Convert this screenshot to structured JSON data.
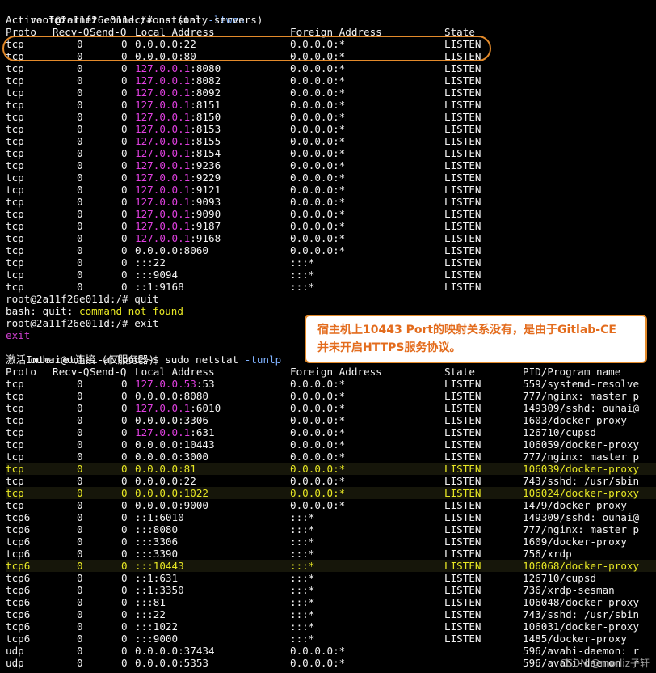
{
  "session1": {
    "prompt": "root@2a11f26e011d:/# netstat",
    "flags": "-ltwen",
    "title": "Active Internet connections (only servers)",
    "header": [
      "Proto",
      "Recv-Q",
      "Send-Q",
      "Local Address",
      "Foreign Address",
      "State"
    ],
    "rows": [
      {
        "proto": "tcp",
        "recv": "0",
        "send": "0",
        "ip": "0.0.0.0",
        "port": ":22",
        "foreign": "0.0.0.0:*",
        "state": "LISTEN",
        "loop": false
      },
      {
        "proto": "tcp",
        "recv": "0",
        "send": "0",
        "ip": "0.0.0.0",
        "port": ":80",
        "foreign": "0.0.0.0:*",
        "state": "LISTEN",
        "loop": false
      },
      {
        "proto": "tcp",
        "recv": "0",
        "send": "0",
        "ip": "127.0.0.1",
        "port": ":8080",
        "foreign": "0.0.0.0:*",
        "state": "LISTEN",
        "loop": true
      },
      {
        "proto": "tcp",
        "recv": "0",
        "send": "0",
        "ip": "127.0.0.1",
        "port": ":8082",
        "foreign": "0.0.0.0:*",
        "state": "LISTEN",
        "loop": true
      },
      {
        "proto": "tcp",
        "recv": "0",
        "send": "0",
        "ip": "127.0.0.1",
        "port": ":8092",
        "foreign": "0.0.0.0:*",
        "state": "LISTEN",
        "loop": true
      },
      {
        "proto": "tcp",
        "recv": "0",
        "send": "0",
        "ip": "127.0.0.1",
        "port": ":8151",
        "foreign": "0.0.0.0:*",
        "state": "LISTEN",
        "loop": true
      },
      {
        "proto": "tcp",
        "recv": "0",
        "send": "0",
        "ip": "127.0.0.1",
        "port": ":8150",
        "foreign": "0.0.0.0:*",
        "state": "LISTEN",
        "loop": true
      },
      {
        "proto": "tcp",
        "recv": "0",
        "send": "0",
        "ip": "127.0.0.1",
        "port": ":8153",
        "foreign": "0.0.0.0:*",
        "state": "LISTEN",
        "loop": true
      },
      {
        "proto": "tcp",
        "recv": "0",
        "send": "0",
        "ip": "127.0.0.1",
        "port": ":8155",
        "foreign": "0.0.0.0:*",
        "state": "LISTEN",
        "loop": true
      },
      {
        "proto": "tcp",
        "recv": "0",
        "send": "0",
        "ip": "127.0.0.1",
        "port": ":8154",
        "foreign": "0.0.0.0:*",
        "state": "LISTEN",
        "loop": true
      },
      {
        "proto": "tcp",
        "recv": "0",
        "send": "0",
        "ip": "127.0.0.1",
        "port": ":9236",
        "foreign": "0.0.0.0:*",
        "state": "LISTEN",
        "loop": true
      },
      {
        "proto": "tcp",
        "recv": "0",
        "send": "0",
        "ip": "127.0.0.1",
        "port": ":9229",
        "foreign": "0.0.0.0:*",
        "state": "LISTEN",
        "loop": true
      },
      {
        "proto": "tcp",
        "recv": "0",
        "send": "0",
        "ip": "127.0.0.1",
        "port": ":9121",
        "foreign": "0.0.0.0:*",
        "state": "LISTEN",
        "loop": true
      },
      {
        "proto": "tcp",
        "recv": "0",
        "send": "0",
        "ip": "127.0.0.1",
        "port": ":9093",
        "foreign": "0.0.0.0:*",
        "state": "LISTEN",
        "loop": true
      },
      {
        "proto": "tcp",
        "recv": "0",
        "send": "0",
        "ip": "127.0.0.1",
        "port": ":9090",
        "foreign": "0.0.0.0:*",
        "state": "LISTEN",
        "loop": true
      },
      {
        "proto": "tcp",
        "recv": "0",
        "send": "0",
        "ip": "127.0.0.1",
        "port": ":9187",
        "foreign": "0.0.0.0:*",
        "state": "LISTEN",
        "loop": true
      },
      {
        "proto": "tcp",
        "recv": "0",
        "send": "0",
        "ip": "127.0.0.1",
        "port": ":9168",
        "foreign": "0.0.0.0:*",
        "state": "LISTEN",
        "loop": true
      },
      {
        "proto": "tcp",
        "recv": "0",
        "send": "0",
        "ip": "0.0.0.0",
        "port": ":8060",
        "foreign": "0.0.0.0:*",
        "state": "LISTEN",
        "loop": false
      },
      {
        "proto": "tcp",
        "recv": "0",
        "send": "0",
        "ip": "::",
        "port": ":22",
        "foreign": ":::*",
        "state": "LISTEN",
        "loop": false
      },
      {
        "proto": "tcp",
        "recv": "0",
        "send": "0",
        "ip": "::",
        "port": ":9094",
        "foreign": ":::*",
        "state": "LISTEN",
        "loop": false
      },
      {
        "proto": "tcp",
        "recv": "0",
        "send": "0",
        "ip": "::1",
        "port": ":9168",
        "foreign": ":::*",
        "state": "LISTEN",
        "loop": false
      }
    ],
    "quit_prompt": "root@2a11f26e011d:/# quit",
    "bash_prefix": "bash: quit: ",
    "bash_error": "command not found",
    "exit_prompt": "root@2a11f26e011d:/# exit",
    "exit_echo": "exit"
  },
  "session2": {
    "prompt": "ouhai@ouhai-acloud:~$ sudo netstat",
    "flags": "-tunlp",
    "title": "激活Internet连接 (仅服务器)",
    "header": [
      "Proto",
      "Recv-Q",
      "Send-Q",
      "Local Address",
      "Foreign Address",
      "State",
      "PID/Program name"
    ],
    "rows": [
      {
        "proto": "tcp",
        "recv": "0",
        "send": "0",
        "ip": "127.0.0.53",
        "port": ":53",
        "foreign": "0.0.0.0:*",
        "state": "LISTEN",
        "pid": "559/systemd-resolve",
        "loop": true,
        "hl": false
      },
      {
        "proto": "tcp",
        "recv": "0",
        "send": "0",
        "ip": "0.0.0.0",
        "port": ":8080",
        "foreign": "0.0.0.0:*",
        "state": "LISTEN",
        "pid": "777/nginx: master p",
        "loop": false,
        "hl": false
      },
      {
        "proto": "tcp",
        "recv": "0",
        "send": "0",
        "ip": "127.0.0.1",
        "port": ":6010",
        "foreign": "0.0.0.0:*",
        "state": "LISTEN",
        "pid": "149309/sshd: ouhai@",
        "loop": true,
        "hl": false
      },
      {
        "proto": "tcp",
        "recv": "0",
        "send": "0",
        "ip": "0.0.0.0",
        "port": ":3306",
        "foreign": "0.0.0.0:*",
        "state": "LISTEN",
        "pid": "1603/docker-proxy",
        "loop": false,
        "hl": false
      },
      {
        "proto": "tcp",
        "recv": "0",
        "send": "0",
        "ip": "127.0.0.1",
        "port": ":631",
        "foreign": "0.0.0.0:*",
        "state": "LISTEN",
        "pid": "126710/cupsd",
        "loop": true,
        "hl": false
      },
      {
        "proto": "tcp",
        "recv": "0",
        "send": "0",
        "ip": "0.0.0.0",
        "port": ":10443",
        "foreign": "0.0.0.0:*",
        "state": "LISTEN",
        "pid": "106059/docker-proxy",
        "loop": false,
        "hl": false
      },
      {
        "proto": "tcp",
        "recv": "0",
        "send": "0",
        "ip": "0.0.0.0",
        "port": ":3000",
        "foreign": "0.0.0.0:*",
        "state": "LISTEN",
        "pid": "777/nginx: master p",
        "loop": false,
        "hl": false
      },
      {
        "proto": "tcp",
        "recv": "0",
        "send": "0",
        "ip": "0.0.0.0",
        "port": ":81",
        "foreign": "0.0.0.0:*",
        "state": "LISTEN",
        "pid": "106039/docker-proxy",
        "loop": false,
        "hl": true
      },
      {
        "proto": "tcp",
        "recv": "0",
        "send": "0",
        "ip": "0.0.0.0",
        "port": ":22",
        "foreign": "0.0.0.0:*",
        "state": "LISTEN",
        "pid": "743/sshd: /usr/sbin",
        "loop": false,
        "hl": false
      },
      {
        "proto": "tcp",
        "recv": "0",
        "send": "0",
        "ip": "0.0.0.0",
        "port": ":1022",
        "foreign": "0.0.0.0:*",
        "state": "LISTEN",
        "pid": "106024/docker-proxy",
        "loop": false,
        "hl": true
      },
      {
        "proto": "tcp",
        "recv": "0",
        "send": "0",
        "ip": "0.0.0.0",
        "port": ":9000",
        "foreign": "0.0.0.0:*",
        "state": "LISTEN",
        "pid": "1479/docker-proxy",
        "loop": false,
        "hl": false
      },
      {
        "proto": "tcp6",
        "recv": "0",
        "send": "0",
        "ip": "::1",
        "port": ":6010",
        "foreign": ":::*",
        "state": "LISTEN",
        "pid": "149309/sshd: ouhai@",
        "loop": false,
        "hl": false
      },
      {
        "proto": "tcp6",
        "recv": "0",
        "send": "0",
        "ip": "::",
        "port": ":8080",
        "foreign": ":::*",
        "state": "LISTEN",
        "pid": "777/nginx: master p",
        "loop": false,
        "hl": false
      },
      {
        "proto": "tcp6",
        "recv": "0",
        "send": "0",
        "ip": "::",
        "port": ":3306",
        "foreign": ":::*",
        "state": "LISTEN",
        "pid": "1609/docker-proxy",
        "loop": false,
        "hl": false
      },
      {
        "proto": "tcp6",
        "recv": "0",
        "send": "0",
        "ip": "::",
        "port": ":3390",
        "foreign": ":::*",
        "state": "LISTEN",
        "pid": "756/xrdp",
        "loop": false,
        "hl": false
      },
      {
        "proto": "tcp6",
        "recv": "0",
        "send": "0",
        "ip": "::",
        "port": ":10443",
        "foreign": ":::*",
        "state": "LISTEN",
        "pid": "106068/docker-proxy",
        "loop": false,
        "hl": true
      },
      {
        "proto": "tcp6",
        "recv": "0",
        "send": "0",
        "ip": "::1",
        "port": ":631",
        "foreign": ":::*",
        "state": "LISTEN",
        "pid": "126710/cupsd",
        "loop": false,
        "hl": false
      },
      {
        "proto": "tcp6",
        "recv": "0",
        "send": "0",
        "ip": "::1",
        "port": ":3350",
        "foreign": ":::*",
        "state": "LISTEN",
        "pid": "736/xrdp-sesman",
        "loop": false,
        "hl": false
      },
      {
        "proto": "tcp6",
        "recv": "0",
        "send": "0",
        "ip": "::",
        "port": ":81",
        "foreign": ":::*",
        "state": "LISTEN",
        "pid": "106048/docker-proxy",
        "loop": false,
        "hl": false
      },
      {
        "proto": "tcp6",
        "recv": "0",
        "send": "0",
        "ip": "::",
        "port": ":22",
        "foreign": ":::*",
        "state": "LISTEN",
        "pid": "743/sshd: /usr/sbin",
        "loop": false,
        "hl": false
      },
      {
        "proto": "tcp6",
        "recv": "0",
        "send": "0",
        "ip": "::",
        "port": ":1022",
        "foreign": ":::*",
        "state": "LISTEN",
        "pid": "106031/docker-proxy",
        "loop": false,
        "hl": false
      },
      {
        "proto": "tcp6",
        "recv": "0",
        "send": "0",
        "ip": "::",
        "port": ":9000",
        "foreign": ":::*",
        "state": "LISTEN",
        "pid": "1485/docker-proxy",
        "loop": false,
        "hl": false
      },
      {
        "proto": "udp",
        "recv": "0",
        "send": "0",
        "ip": "0.0.0.0",
        "port": ":37434",
        "foreign": "0.0.0.0:*",
        "state": "",
        "pid": "596/avahi-daemon: r",
        "loop": false,
        "hl": false
      },
      {
        "proto": "udp",
        "recv": "0",
        "send": "0",
        "ip": "0.0.0.0",
        "port": ":5353",
        "foreign": "0.0.0.0:*",
        "state": "",
        "pid": "596/avahi-daemon: r",
        "loop": false,
        "hl": false
      }
    ]
  },
  "callout": {
    "line1": "宿主机上10443 Port的映射关系没有，是由于Gitlab-CE",
    "line2": "并未开启HTTPS服务协议。"
  },
  "watermark": "CSDN @morliz子轩",
  "colors": {
    "background": "#000000",
    "text": "#f2f2f2",
    "loopback": "#e040e0",
    "flag": "#7fb2ff",
    "highlight": "#e8e824",
    "annotation": "#e38a2b"
  }
}
